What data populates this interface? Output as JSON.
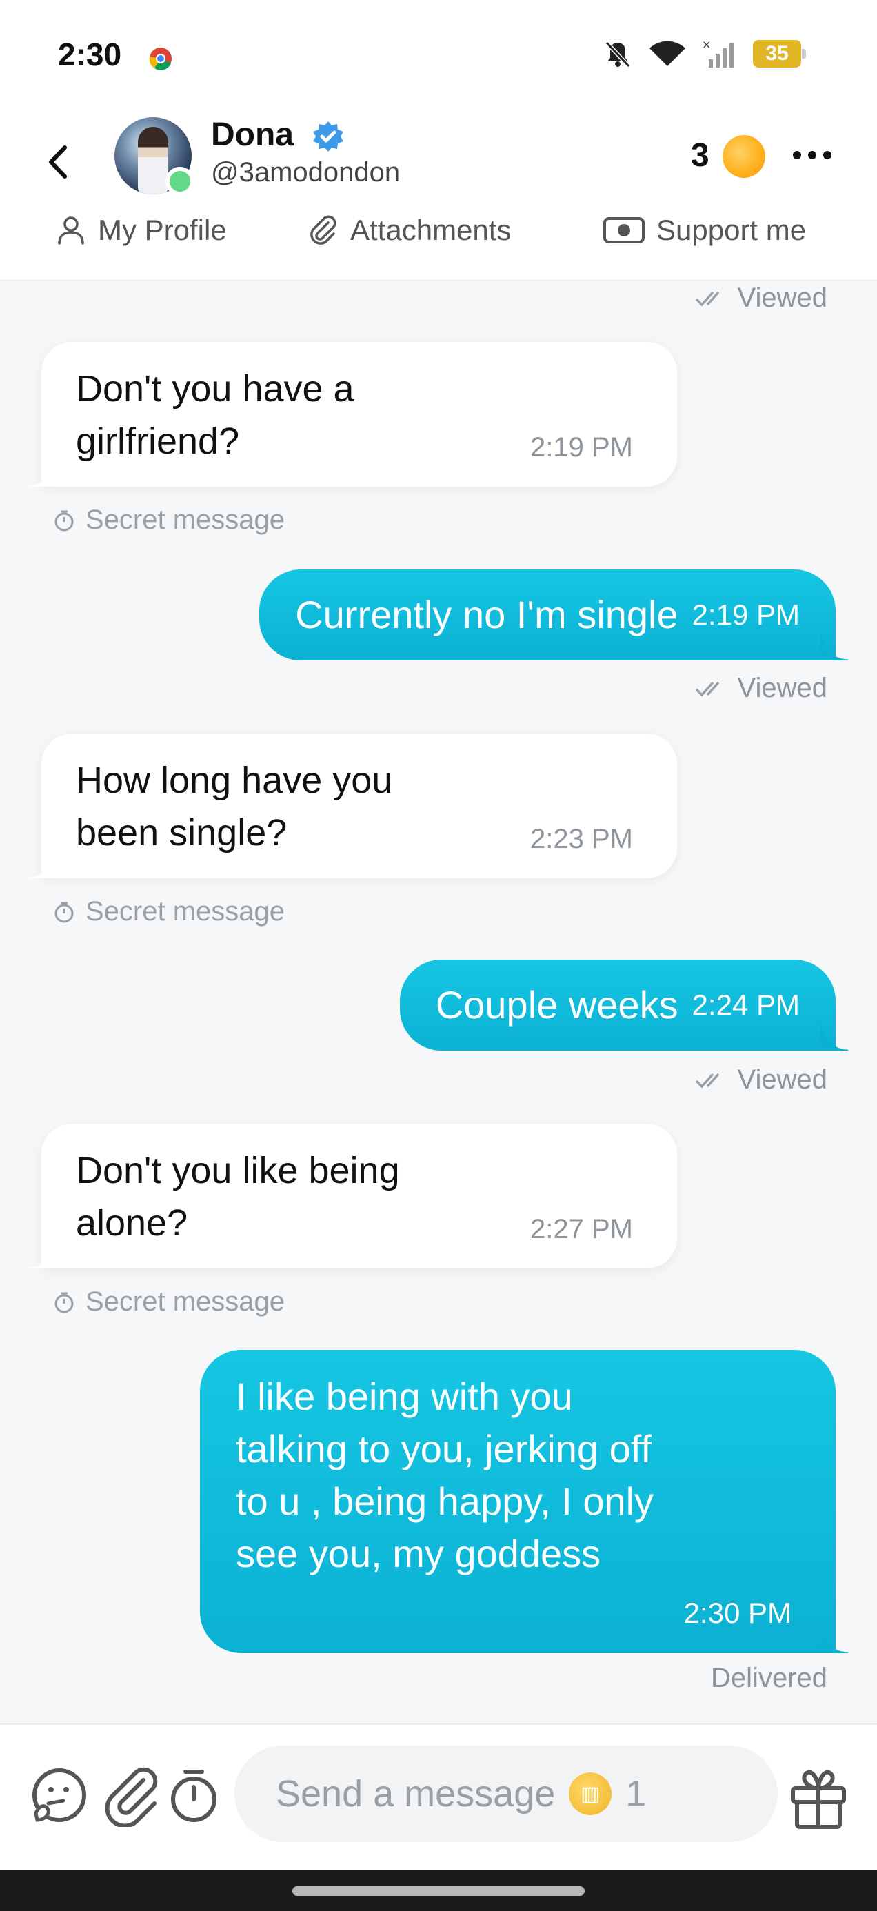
{
  "status_bar": {
    "time": "2:30",
    "battery": "35"
  },
  "header": {
    "name": "Dona",
    "handle": "@3amodondon",
    "coin_count": "3"
  },
  "tabs": [
    {
      "label": "My Profile",
      "icon": "person-icon"
    },
    {
      "label": "Attachments",
      "icon": "paperclip-icon"
    },
    {
      "label": "Support me",
      "icon": "cash-icon"
    }
  ],
  "chat": {
    "top_status": "Viewed",
    "messages": [
      {
        "dir": "in",
        "text": "Don't you have a girlfriend?",
        "time": "2:19 PM",
        "note": "Secret message"
      },
      {
        "dir": "out",
        "text": "Currently no I'm single",
        "time": "2:19 PM",
        "status": "Viewed"
      },
      {
        "dir": "in",
        "text": "How long have you been single?",
        "time": "2:23 PM",
        "note": "Secret message"
      },
      {
        "dir": "out",
        "text": "Couple weeks",
        "time": "2:24 PM",
        "status": "Viewed"
      },
      {
        "dir": "in",
        "text": "Don't you like being alone?",
        "time": "2:27 PM",
        "note": "Secret message"
      },
      {
        "dir": "out",
        "text": "I like being with you talking to you, jerking off to u , being happy, I only see you, my goddess",
        "time": "2:30 PM",
        "status": "Delivered"
      }
    ]
  },
  "composer": {
    "placeholder": "Send a message",
    "cost": "1"
  },
  "colors": {
    "accent": "#0fbcdc",
    "online": "#62d989",
    "verified": "#3d9ae8",
    "coin": "#ffb21f"
  }
}
